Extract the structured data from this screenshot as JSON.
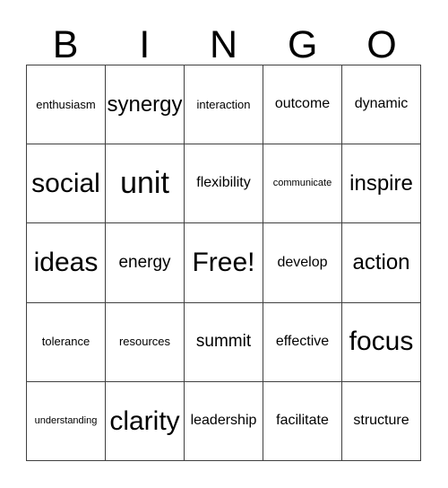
{
  "card": {
    "title": "BINGO",
    "header_letters": [
      "B",
      "I",
      "N",
      "G",
      "O"
    ],
    "free_space_label": "Free!",
    "grid_rows": [
      {
        "cells": [
          {
            "label": "enthusiasm",
            "size": "fs-s",
            "free": false
          },
          {
            "label": "synergy",
            "size": "fs-xl",
            "free": false
          },
          {
            "label": "interaction",
            "size": "fs-s",
            "free": false
          },
          {
            "label": "outcome",
            "size": "fs-m",
            "free": false
          },
          {
            "label": "dynamic",
            "size": "fs-m",
            "free": false
          }
        ]
      },
      {
        "cells": [
          {
            "label": "social",
            "size": "fs-xxl",
            "free": false
          },
          {
            "label": "unit",
            "size": "fs-huge",
            "free": false
          },
          {
            "label": "flexibility",
            "size": "fs-m",
            "free": false
          },
          {
            "label": "communicate",
            "size": "fs-xs",
            "free": false
          },
          {
            "label": "inspire",
            "size": "fs-xl",
            "free": false
          }
        ]
      },
      {
        "cells": [
          {
            "label": "ideas",
            "size": "fs-xxl",
            "free": false
          },
          {
            "label": "energy",
            "size": "fs-l",
            "free": false
          },
          {
            "label": "Free!",
            "size": "fs-xxl",
            "free": true
          },
          {
            "label": "develop",
            "size": "fs-m",
            "free": false
          },
          {
            "label": "action",
            "size": "fs-xl",
            "free": false
          }
        ]
      },
      {
        "cells": [
          {
            "label": "tolerance",
            "size": "fs-s",
            "free": false
          },
          {
            "label": "resources",
            "size": "fs-s",
            "free": false
          },
          {
            "label": "summit",
            "size": "fs-l",
            "free": false
          },
          {
            "label": "effective",
            "size": "fs-m",
            "free": false
          },
          {
            "label": "focus",
            "size": "fs-xxl",
            "free": false
          }
        ]
      },
      {
        "cells": [
          {
            "label": "understanding",
            "size": "fs-xs",
            "free": false
          },
          {
            "label": "clarity",
            "size": "fs-xxl",
            "free": false
          },
          {
            "label": "leadership",
            "size": "fs-m",
            "free": false
          },
          {
            "label": "facilitate",
            "size": "fs-m",
            "free": false
          },
          {
            "label": "structure",
            "size": "fs-m",
            "free": false
          }
        ]
      }
    ]
  },
  "colors": {
    "background": "#ffffff",
    "text": "#000000",
    "grid_line": "#404040"
  }
}
